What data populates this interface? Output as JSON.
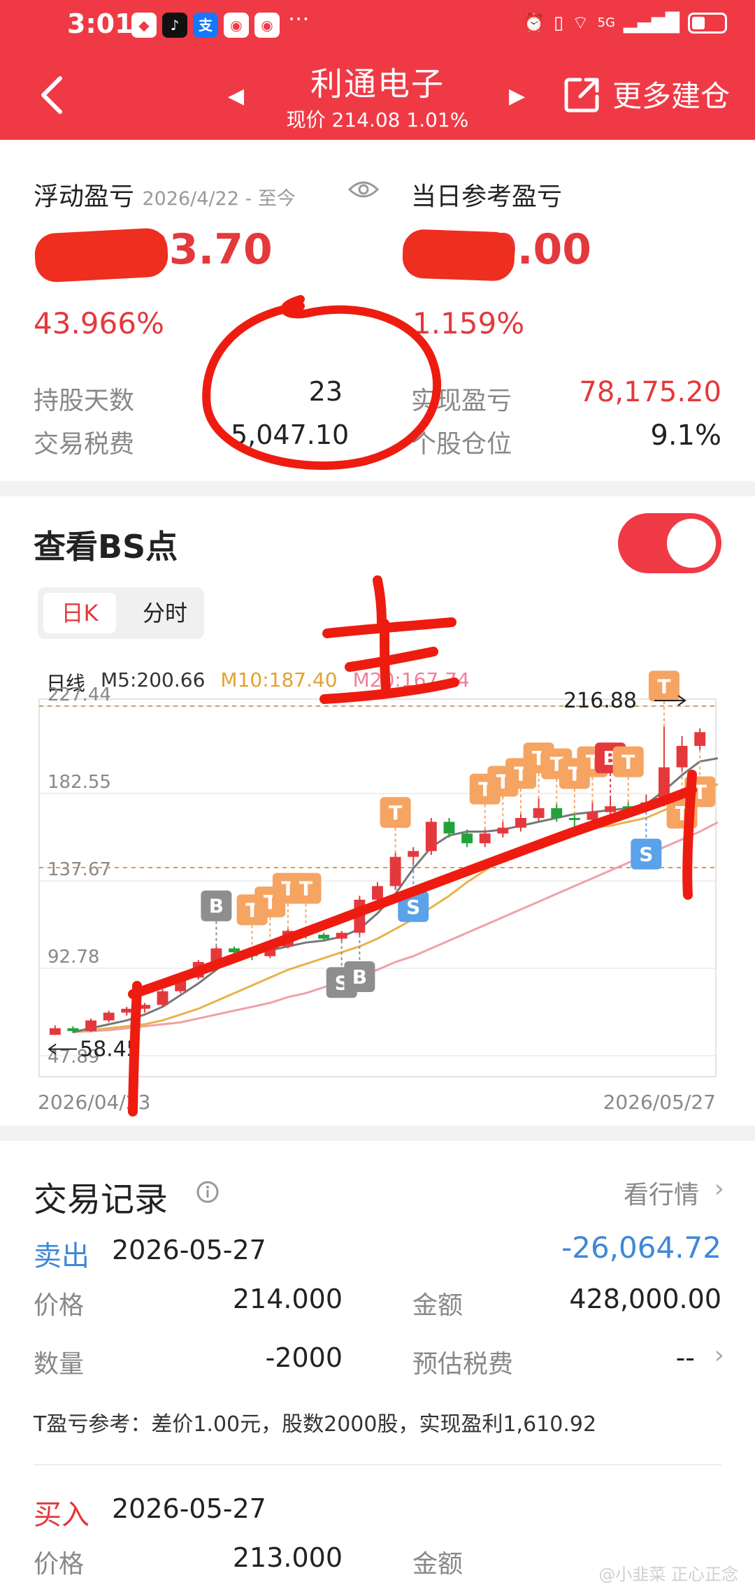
{
  "status_bar": {
    "time": "3:01",
    "app_icons": [
      "huawei",
      "tiktok",
      "alipay",
      "weibo",
      "weibo"
    ],
    "alipay_glyph": "支",
    "more_dots": "···",
    "signal": "5G"
  },
  "header": {
    "stock_name": "利通电子",
    "price_line": "现价 214.08 1.01%",
    "more_label": "更多建仓"
  },
  "summary": {
    "float_pl_label": "浮动盈亏",
    "float_pl_range": "2026/4/22 - 至今",
    "float_pl_value": "33.70",
    "float_pl_pct": "43.966%",
    "today_pl_label": "当日参考盈亏",
    "today_pl_value": "0.00",
    "today_pl_pct": "1.159%",
    "hold_days_label": "持股天数",
    "hold_days_value": "23",
    "realized_label": "实现盈亏",
    "realized_value": "78,175.20",
    "fee_label": "交易税费",
    "fee_value": "5,047.10",
    "position_label": "个股仓位",
    "position_value": "9.1%"
  },
  "bs": {
    "title": "查看BS点",
    "tab_day": "日K",
    "tab_min": "分时",
    "ma_label": "日线",
    "ma5": "M5:200.66",
    "ma10": "M10:187.40",
    "ma20": "M20:167.74",
    "handwriting": "主"
  },
  "chart_data": {
    "type": "candlestick",
    "y_ticks": [
      "227.44",
      "182.55",
      "137.67",
      "92.78",
      "47.89"
    ],
    "ylim": [
      47.89,
      227.44
    ],
    "x_start": "2026/04/23",
    "x_end": "2026/05/27",
    "max_label": "216.88",
    "min_label": "58.45",
    "reference_price": 144.5,
    "colors": {
      "up": "#e4393c",
      "down": "#22a33a",
      "ma5": "#777777",
      "ma10": "#e8b34a",
      "ma20": "#f1a0a8"
    },
    "candles": [
      {
        "o": 58.6,
        "c": 62.0,
        "h": 63.5,
        "l": 58.45
      },
      {
        "o": 62.0,
        "c": 60.5,
        "h": 63.0,
        "l": 59.5
      },
      {
        "o": 60.5,
        "c": 66.0,
        "h": 67.0,
        "l": 60.0
      },
      {
        "o": 66.0,
        "c": 70.0,
        "h": 71.0,
        "l": 65.0
      },
      {
        "o": 70.0,
        "c": 72.0,
        "h": 73.0,
        "l": 68.5
      },
      {
        "o": 72.0,
        "c": 74.0,
        "h": 75.0,
        "l": 70.0
      },
      {
        "o": 74.0,
        "c": 81.0,
        "h": 82.0,
        "l": 73.0
      },
      {
        "o": 81.0,
        "c": 88.0,
        "h": 89.0,
        "l": 80.0
      },
      {
        "o": 88.0,
        "c": 96.0,
        "h": 97.0,
        "l": 87.0
      },
      {
        "o": 96.0,
        "c": 103.0,
        "h": 104.0,
        "l": 95.0
      },
      {
        "o": 103.0,
        "c": 101.0,
        "h": 104.0,
        "l": 98.0
      },
      {
        "o": 101.0,
        "c": 99.0,
        "h": 102.0,
        "l": 97.0
      },
      {
        "o": 99.0,
        "c": 104.0,
        "h": 106.0,
        "l": 98.0
      },
      {
        "o": 104.0,
        "c": 112.0,
        "h": 113.0,
        "l": 103.0
      },
      {
        "o": 112.0,
        "c": 110.0,
        "h": 113.0,
        "l": 108.0
      },
      {
        "o": 110.0,
        "c": 108.0,
        "h": 111.0,
        "l": 107.0
      },
      {
        "o": 108.0,
        "c": 111.0,
        "h": 112.0,
        "l": 107.0
      },
      {
        "o": 111.0,
        "c": 128.0,
        "h": 130.0,
        "l": 110.0
      },
      {
        "o": 128.0,
        "c": 135.0,
        "h": 137.0,
        "l": 127.0
      },
      {
        "o": 135.0,
        "c": 150.0,
        "h": 152.0,
        "l": 133.0
      },
      {
        "o": 150.0,
        "c": 153.0,
        "h": 155.0,
        "l": 146.0
      },
      {
        "o": 153.0,
        "c": 168.0,
        "h": 170.0,
        "l": 151.0
      },
      {
        "o": 168.0,
        "c": 162.0,
        "h": 170.0,
        "l": 160.0
      },
      {
        "o": 162.0,
        "c": 157.0,
        "h": 164.0,
        "l": 155.0
      },
      {
        "o": 157.0,
        "c": 162.0,
        "h": 164.0,
        "l": 155.0
      },
      {
        "o": 162.0,
        "c": 165.0,
        "h": 168.0,
        "l": 160.0
      },
      {
        "o": 165.0,
        "c": 170.0,
        "h": 172.0,
        "l": 163.0
      },
      {
        "o": 170.0,
        "c": 175.0,
        "h": 180.0,
        "l": 168.0
      },
      {
        "o": 175.0,
        "c": 170.0,
        "h": 177.0,
        "l": 168.0
      },
      {
        "o": 170.0,
        "c": 169.0,
        "h": 172.0,
        "l": 162.0
      },
      {
        "o": 169.0,
        "c": 173.0,
        "h": 178.0,
        "l": 167.0
      },
      {
        "o": 173.0,
        "c": 176.0,
        "h": 180.0,
        "l": 171.0
      },
      {
        "o": 176.0,
        "c": 175.0,
        "h": 178.0,
        "l": 172.0
      },
      {
        "o": 175.0,
        "c": 178.0,
        "h": 182.0,
        "l": 173.0
      },
      {
        "o": 178.0,
        "c": 196.0,
        "h": 216.88,
        "l": 176.0
      },
      {
        "o": 196.0,
        "c": 207.0,
        "h": 212.0,
        "l": 194.0
      },
      {
        "o": 207.0,
        "c": 214.08,
        "h": 216.0,
        "l": 205.0
      }
    ],
    "ma5": [
      60,
      62,
      64,
      66,
      69,
      73,
      79,
      85,
      92,
      99,
      101,
      102,
      104,
      106,
      107,
      109,
      113,
      121,
      131,
      144,
      155,
      161,
      163,
      163,
      164,
      166,
      168,
      170,
      172,
      173,
      174,
      175,
      177,
      184,
      192,
      199,
      200.66
    ],
    "ma10": [
      60,
      61,
      62,
      63,
      64,
      66,
      69,
      72,
      76,
      80,
      84,
      88,
      92,
      95,
      98,
      101,
      104,
      108,
      113,
      118,
      124,
      130,
      137,
      143,
      149,
      154,
      158,
      161,
      163,
      165,
      166,
      168,
      170,
      174,
      178,
      183,
      187.4
    ],
    "ma20": [
      60,
      60.5,
      61,
      62,
      63,
      64,
      65,
      67,
      69,
      71,
      73,
      75,
      78,
      80,
      83,
      86,
      89,
      92,
      96,
      99,
      103,
      107,
      111,
      115,
      119,
      123,
      127,
      131,
      135,
      139,
      143,
      147,
      151,
      155,
      159,
      163,
      167.74
    ],
    "markers": [
      {
        "i": 9,
        "label": "B",
        "kind": "grey",
        "side": "above"
      },
      {
        "i": 11,
        "label": "T",
        "kind": "orange",
        "side": "above"
      },
      {
        "i": 12,
        "label": "T",
        "kind": "orange",
        "side": "above"
      },
      {
        "i": 13,
        "label": "T",
        "kind": "orange",
        "side": "above"
      },
      {
        "i": 14,
        "label": "T",
        "kind": "orange",
        "side": "above"
      },
      {
        "i": 16,
        "label": "S",
        "kind": "grey",
        "side": "below"
      },
      {
        "i": 17,
        "label": "B",
        "kind": "grey",
        "side": "below"
      },
      {
        "i": 19,
        "label": "T",
        "kind": "orange",
        "side": "above"
      },
      {
        "i": 20,
        "label": "S",
        "kind": "blue",
        "side": "below"
      },
      {
        "i": 24,
        "label": "T",
        "kind": "orange",
        "side": "above"
      },
      {
        "i": 25,
        "label": "T",
        "kind": "orange",
        "side": "above"
      },
      {
        "i": 26,
        "label": "T",
        "kind": "orange",
        "side": "above"
      },
      {
        "i": 27,
        "label": "T",
        "kind": "orange",
        "side": "above"
      },
      {
        "i": 28,
        "label": "T",
        "kind": "orange",
        "side": "above"
      },
      {
        "i": 29,
        "label": "T",
        "kind": "orange",
        "side": "above"
      },
      {
        "i": 30,
        "label": "T",
        "kind": "orange",
        "side": "above"
      },
      {
        "i": 31,
        "label": "B",
        "kind": "red",
        "side": "above"
      },
      {
        "i": 32,
        "label": "T",
        "kind": "orange",
        "side": "above"
      },
      {
        "i": 33,
        "label": "S",
        "kind": "blue",
        "side": "below"
      },
      {
        "i": 34,
        "label": "T",
        "kind": "orange",
        "side": "above"
      },
      {
        "i": 35,
        "label": "T",
        "kind": "orange",
        "side": "below"
      },
      {
        "i": 36,
        "label": "T",
        "kind": "orange",
        "side": "below"
      }
    ]
  },
  "trades": {
    "title": "交易记录",
    "link": "看行情",
    "sell": {
      "type": "卖出",
      "date": "2026-05-27",
      "amount_change": "-26,064.72",
      "price_label": "价格",
      "price": "214.000",
      "total_label": "金额",
      "total": "428,000.00",
      "qty_label": "数量",
      "qty": "-2000",
      "tax_label": "预估税费",
      "tax": "--",
      "t_note": "T盈亏参考：差价1.00元，股数2000股，实现盈利1,610.92"
    },
    "buy": {
      "type": "买入",
      "date": "2026-05-27",
      "price_label": "价格",
      "price": "213.000",
      "total_label": "金额"
    }
  },
  "watermark": "@小韭菜 正心正念"
}
